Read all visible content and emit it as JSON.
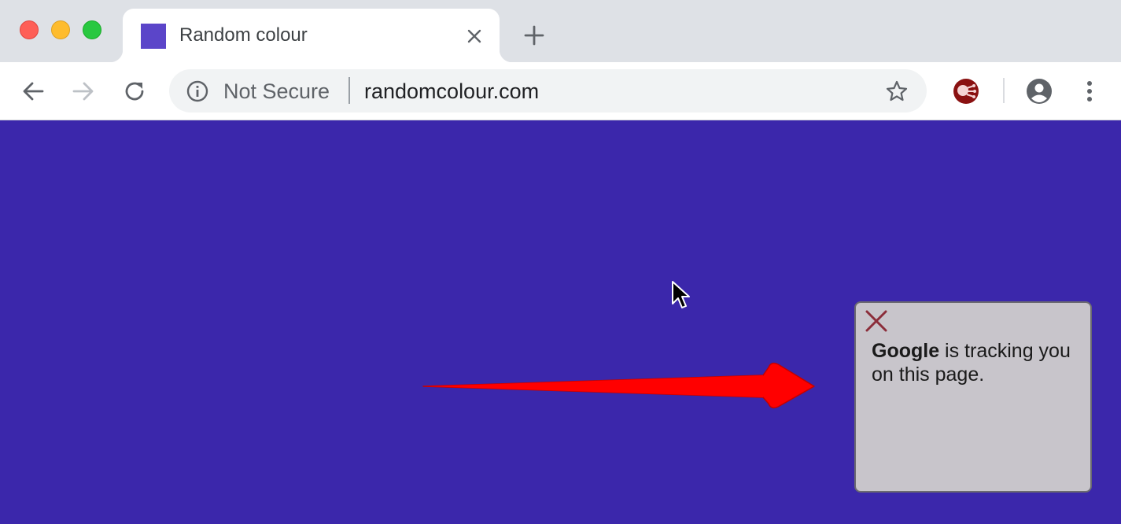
{
  "browser": {
    "tab": {
      "title": "Random colour",
      "favicon_color": "#5b45c9"
    },
    "address_bar": {
      "security_label": "Not Secure",
      "url": "randomcolour.com"
    }
  },
  "page": {
    "background_color": "#3b27ab",
    "tracker_popup": {
      "company": "Google",
      "message": " is tracking you on this page."
    }
  },
  "icons": {
    "window_controls": [
      "close-dot",
      "minimize-dot",
      "zoom-dot"
    ],
    "tab": [
      "favicon",
      "close-icon"
    ],
    "toolbar": [
      "back-arrow-icon",
      "forward-arrow-icon",
      "reload-icon",
      "info-icon",
      "star-icon",
      "extension-icon",
      "profile-icon",
      "kebab-menu-icon"
    ],
    "page": [
      "red-arrow-annotation",
      "mouse-cursor"
    ]
  }
}
